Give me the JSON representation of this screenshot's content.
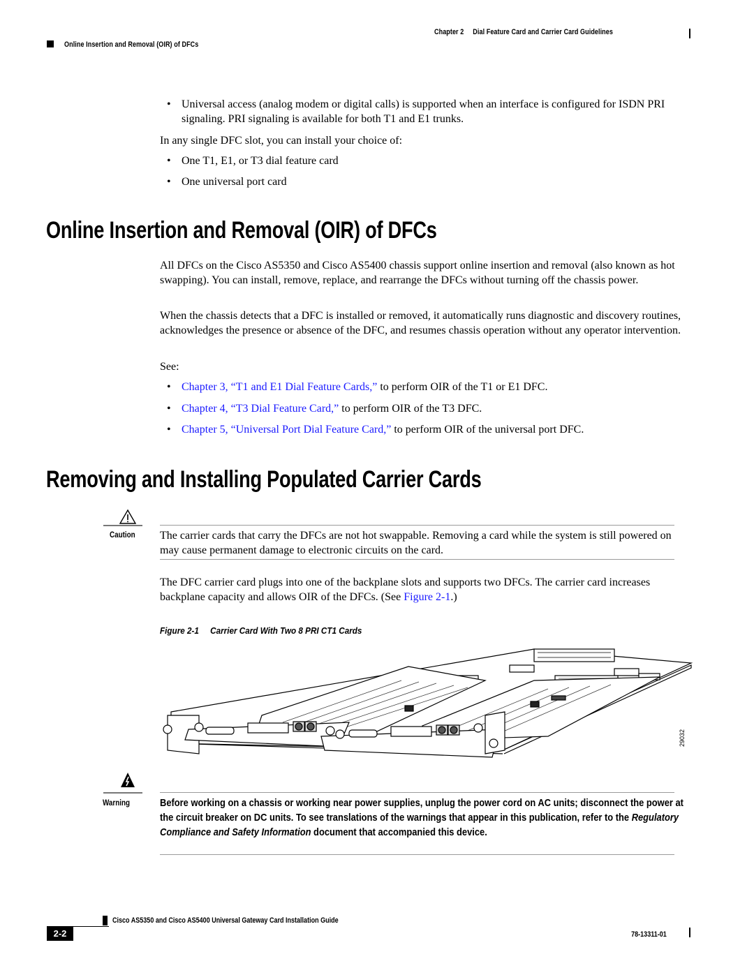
{
  "header": {
    "chapter_label": "Chapter 2",
    "chapter_title": "Dial Feature Card and Carrier Card Guidelines",
    "section_label": "Online Insertion and Removal (OIR) of DFCs"
  },
  "intro": {
    "bullet_universal": "Universal access (analog modem or digital calls) is supported when an interface is configured for ISDN PRI signaling. PRI signaling is available for both T1 and E1 trunks.",
    "choice_intro": "In any single DFC slot, you can install your choice of:",
    "choices": [
      "One T1, E1, or T3 dial feature card",
      "One universal port card"
    ]
  },
  "oir_section": {
    "heading": "Online Insertion and Removal (OIR) of DFCs",
    "para1": "All DFCs on the Cisco AS5350 and Cisco AS5400 chassis support online insertion and removal (also known as hot swapping). You can install, remove, replace, and rearrange the DFCs without turning off the chassis power.",
    "para2": "When the chassis detects that a DFC is installed or removed, it automatically runs diagnostic and discovery routines, acknowledges the presence or absence of the DFC, and resumes chassis operation without any operator intervention.",
    "see_label": "See:",
    "see_items": [
      {
        "link": "Chapter 3, “T1 and E1 Dial Feature Cards,”",
        "rest": " to perform OIR of the T1 or E1 DFC."
      },
      {
        "link": "Chapter 4, “T3 Dial Feature Card,”",
        "rest": " to perform OIR of the T3 DFC."
      },
      {
        "link": "Chapter 5, “Universal Port Dial Feature Card,”",
        "rest": " to perform OIR of the universal port DFC."
      }
    ]
  },
  "carrier_section": {
    "heading": "Removing and Installing Populated Carrier Cards",
    "caution_label": "Caution",
    "caution_text": "The carrier cards that carry the DFCs are not hot swappable. Removing a card while the system is still powered on may cause permanent damage to electronic circuits on the card.",
    "para_before_link": "The DFC carrier card plugs into one of the backplane slots and supports two DFCs. The carrier card increases backplane capacity and allows OIR of the DFCs. (See ",
    "para_link": "Figure 2-1",
    "para_after_link": ".)",
    "figure_number": "Figure 2-1",
    "figure_title": "Carrier Card With Two 8 PRI CT1 Cards",
    "figure_id": "29032",
    "warning_label": "Warning",
    "warning_text_1": "Before working on a chassis or working near power supplies, unplug the power cord on AC units; disconnect the power at the circuit breaker on DC units. To see translations of the warnings that appear in this publication, refer to the ",
    "warning_text_italic": "Regulatory Compliance and Safety Information",
    "warning_text_2": " document that accompanied this device."
  },
  "footer": {
    "guide_title": "Cisco AS5350 and Cisco AS5400 Universal Gateway Card Installation Guide",
    "page_number": "2-2",
    "doc_number": "78-13311-01"
  },
  "colors": {
    "link": "#1a1aff",
    "rule": "#9a9a9a"
  }
}
